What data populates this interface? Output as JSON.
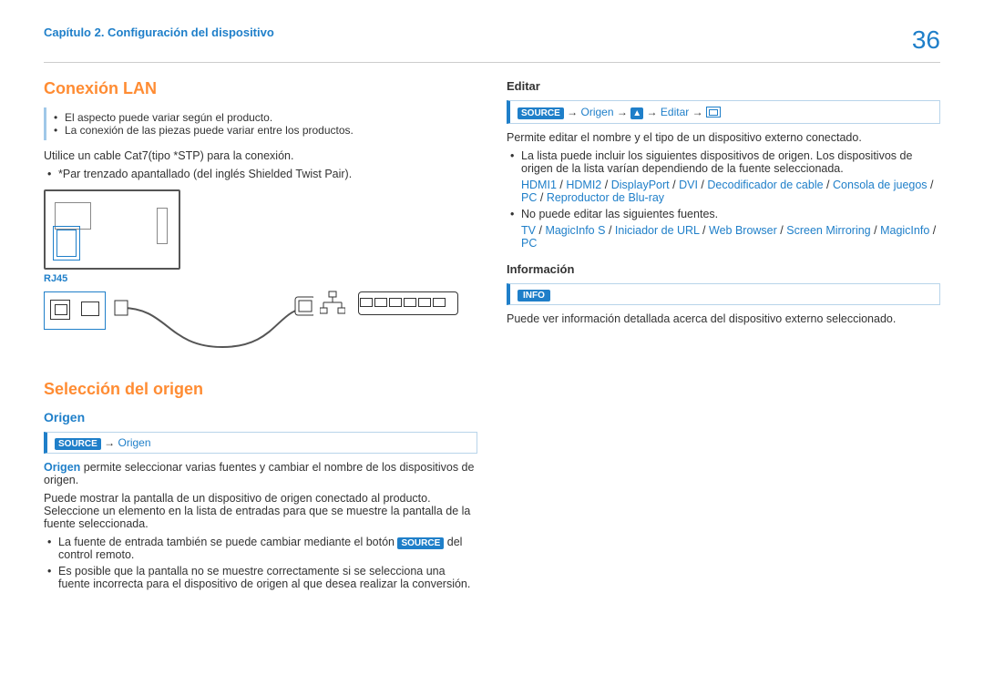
{
  "header": {
    "chapter": "Capítulo 2. Configuración del dispositivo",
    "page": "36"
  },
  "left": {
    "h_lan": "Conexión LAN",
    "info_lan_1": "El aspecto puede variar según el producto.",
    "info_lan_2": "La conexión de las piezas puede variar entre los productos.",
    "cat7": "Utilice un cable Cat7(tipo *STP) para la conexión.",
    "stp": "*Par trenzado apantallado (del inglés Shielded Twist Pair).",
    "rj45": "RJ45",
    "h_sel": "Selección del origen",
    "h_origen": "Origen",
    "path_source": "SOURCE",
    "path_arrow": "→",
    "path_origen": "Origen",
    "origen_bold": "Origen",
    "origen_desc": " permite seleccionar varias fuentes y cambiar el nombre de los dispositivos de origen.",
    "origen_p2": "Puede mostrar la pantalla de un dispositivo de origen conectado al producto. Seleccione un elemento en la lista de entradas para que se muestre la pantalla de la fuente seleccionada.",
    "origen_b1a": "La fuente de entrada también se puede cambiar mediante el botón ",
    "origen_b1b": " del control remoto.",
    "origen_b2": "Es posible que la pantalla no se muestre correctamente si se selecciona una fuente incorrecta para el dispositivo de origen al que desea realizar la conversión."
  },
  "right": {
    "h_editar": "Editar",
    "path_editar": "Editar",
    "editar_p": "Permite editar el nombre y el tipo de un dispositivo externo conectado.",
    "editar_b1": "La lista puede incluir los siguientes dispositivos de origen. Los dispositivos de origen de la lista varían dependiendo de la fuente seleccionada.",
    "sources1": [
      "HDMI1",
      "HDMI2",
      "DisplayPort",
      "DVI",
      "Decodificador de cable",
      "Consola de juegos",
      "PC",
      "Reproductor de Blu-ray"
    ],
    "editar_b2": "No puede editar las siguientes fuentes.",
    "sources2": [
      "TV",
      "MagicInfo S",
      "Iniciador de URL",
      "Web Browser",
      "Screen Mirroring",
      "MagicInfo",
      "PC"
    ],
    "h_info": "Información",
    "info_badge": "INFO",
    "info_p": "Puede ver información detallada acerca del dispositivo externo seleccionado."
  }
}
